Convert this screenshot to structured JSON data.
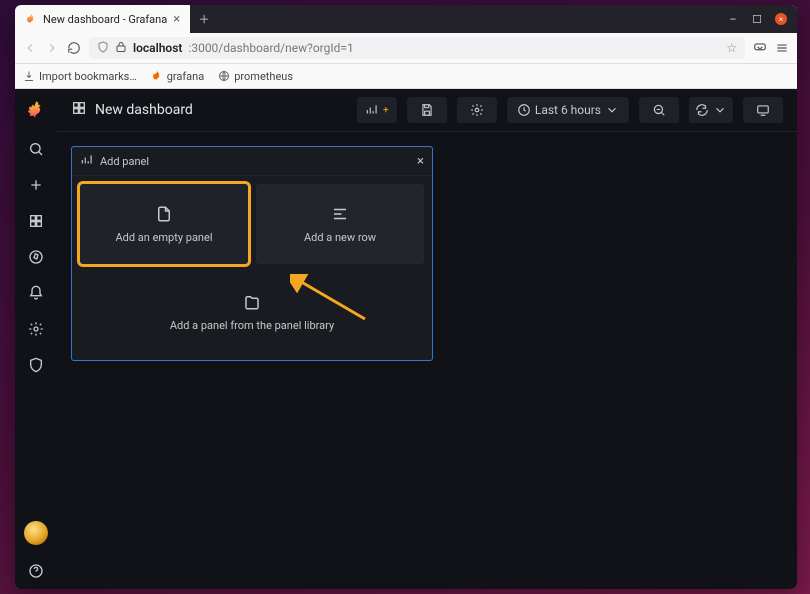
{
  "browser": {
    "tab_title": "New dashboard - Grafana",
    "url_host": "localhost",
    "url_port_path": ":3000/dashboard/new?orgId=1",
    "bookmarks": {
      "import": "Import bookmarks…",
      "grafana": "grafana",
      "prometheus": "prometheus"
    }
  },
  "dashboard": {
    "title": "New dashboard",
    "time_range": "Last 6 hours"
  },
  "add_panel": {
    "title": "Add panel",
    "options": {
      "empty": "Add an empty panel",
      "row": "Add a new row",
      "library": "Add a panel from the panel library"
    }
  }
}
